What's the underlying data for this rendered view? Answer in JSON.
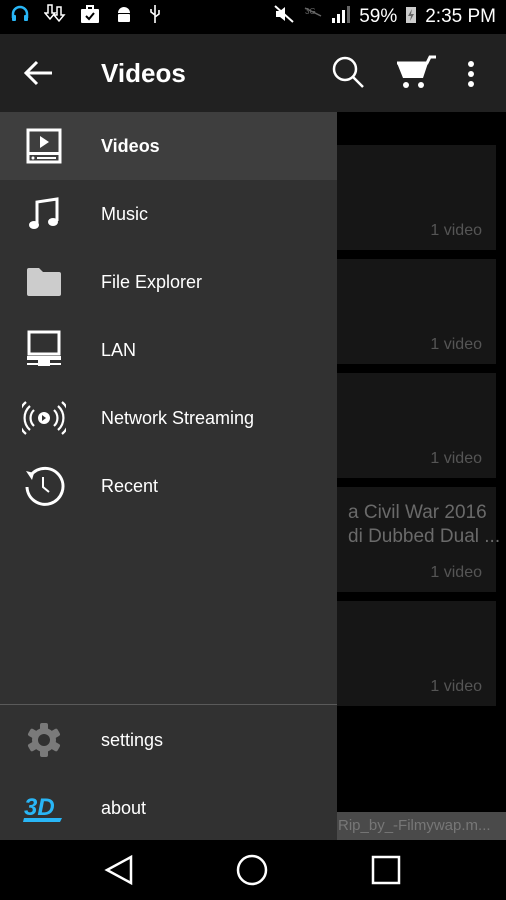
{
  "status_bar": {
    "battery": "59%",
    "time": "2:35 PM",
    "icons": [
      "headset-icon",
      "download-icon",
      "briefcase-check-icon",
      "android-icon",
      "usb-icon",
      "mute-icon",
      "no-data-icon",
      "signal-icon",
      "battery-charging-icon"
    ]
  },
  "toolbar": {
    "title": "Videos",
    "icons": [
      "back-arrow-icon",
      "search-icon",
      "cart-icon",
      "more-vert-icon"
    ]
  },
  "background_list": {
    "cards": [
      {
        "title": "",
        "count": "1 video"
      },
      {
        "title": "",
        "count": "1 video"
      },
      {
        "title": "",
        "count": "1 video"
      },
      {
        "title_line1": "a Civil War 2016",
        "title_line2": "di Dubbed Dual ...",
        "count": "1 video"
      },
      {
        "title": "",
        "count": "1 video"
      }
    ],
    "bottom_text": "Rip_by_-Filmywap.m..."
  },
  "drawer": {
    "items": [
      {
        "label": "Videos",
        "icon": "video-icon",
        "selected": true
      },
      {
        "label": "Music",
        "icon": "music-note-icon"
      },
      {
        "label": "File Explorer",
        "icon": "folder-icon"
      },
      {
        "label": "LAN",
        "icon": "computer-icon"
      },
      {
        "label": "Network Streaming",
        "icon": "streaming-icon"
      },
      {
        "label": "Recent",
        "icon": "history-icon"
      }
    ],
    "footer": [
      {
        "label": "settings",
        "icon": "gear-icon"
      },
      {
        "label": "about",
        "icon": "3d-logo-icon"
      }
    ]
  },
  "colors": {
    "drawer_bg": "#313131",
    "selected_bg": "#3e3e3e",
    "toolbar_bg": "#212121",
    "accent": "#29b6f6"
  }
}
